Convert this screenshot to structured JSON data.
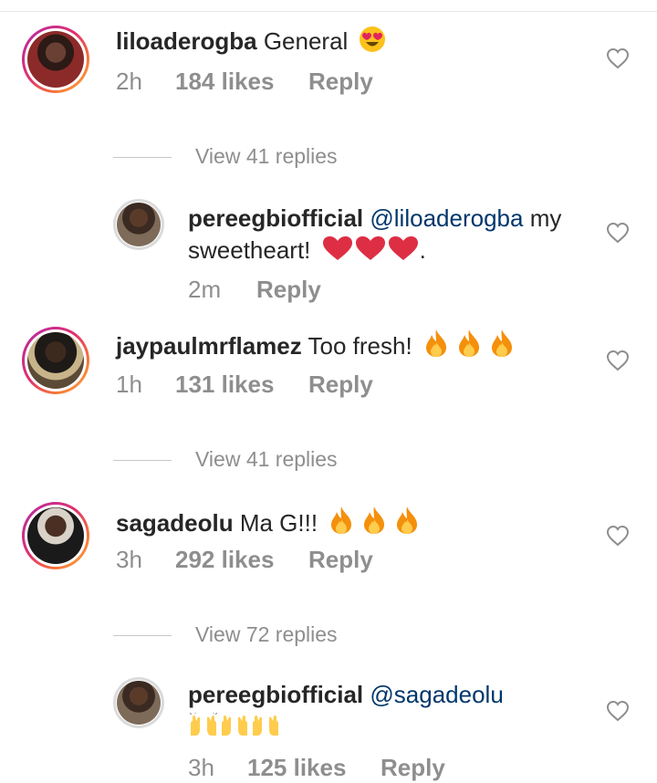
{
  "colors": {
    "username": "#262626",
    "mention": "#00376b",
    "meta": "#8e8e8e",
    "heart_outline": "#8e8e8e"
  },
  "comments": [
    {
      "username": "liloaderogba",
      "text": "General",
      "emojis": [
        "heart-eyes"
      ],
      "time": "2h",
      "likes": "184 likes",
      "reply": "Reply"
    },
    {
      "replies_label": "View 41 replies"
    },
    {
      "username": "pereegbiofficial",
      "mention": "@liloaderogba",
      "text": "my",
      "text_line2": "sweetheart!",
      "text_tail": ".",
      "emojis": [
        "red-heart",
        "red-heart",
        "red-heart"
      ],
      "time": "2m",
      "reply": "Reply"
    },
    {
      "username": "jaypaulmrflamez",
      "text": "Too fresh!",
      "emojis": [
        "fire",
        "fire",
        "fire"
      ],
      "time": "1h",
      "likes": "131 likes",
      "reply": "Reply"
    },
    {
      "replies_label": "View 41 replies"
    },
    {
      "username": "sagadeolu",
      "text": "Ma G!!!",
      "emojis": [
        "fire",
        "fire",
        "fire"
      ],
      "time": "3h",
      "likes": "292 likes",
      "reply": "Reply"
    },
    {
      "replies_label": "View 72 replies"
    },
    {
      "username": "pereegbiofficial",
      "mention": "@sagadeolu",
      "emojis": [
        "raising-hands",
        "raising-hands",
        "raising-hands",
        "raising-hands",
        "raising-hands",
        "raising-hands"
      ],
      "time": "3h",
      "likes": "125 likes",
      "reply": "Reply"
    }
  ]
}
